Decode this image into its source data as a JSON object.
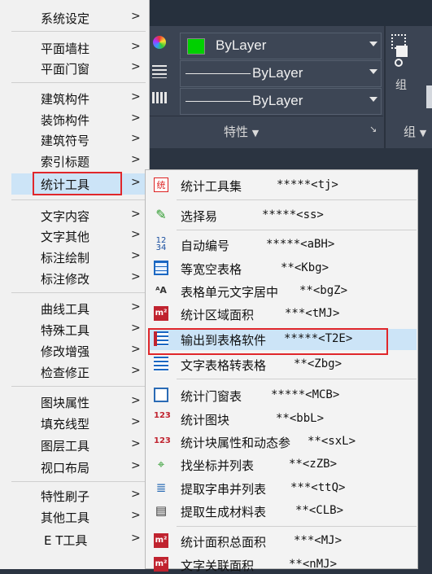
{
  "ribbon": {
    "color_value": "ByLayer",
    "linetype_value": "ByLayer",
    "lineweight_value": "ByLayer",
    "properties_label": "特性",
    "group_label": "组",
    "group_panel_label": "组",
    "color_swatch": "#00d000"
  },
  "left_menu": {
    "items": [
      {
        "label": "系统设定"
      },
      {
        "label": "平面墙柱"
      },
      {
        "label": "平面门窗"
      },
      {
        "label": "建筑构件"
      },
      {
        "label": "装饰构件"
      },
      {
        "label": "建筑符号"
      },
      {
        "label": "索引标题"
      },
      {
        "label": "统计工具"
      },
      {
        "label": "文字内容"
      },
      {
        "label": "文字其他"
      },
      {
        "label": "标注绘制"
      },
      {
        "label": "标注修改"
      },
      {
        "label": "曲线工具"
      },
      {
        "label": "特殊工具"
      },
      {
        "label": "修改增强"
      },
      {
        "label": "检查修正"
      },
      {
        "label": "图块属性"
      },
      {
        "label": "填充线型"
      },
      {
        "label": "图层工具"
      },
      {
        "label": "视口布局"
      },
      {
        "label": "特性刷子"
      },
      {
        "label": "其他工具"
      },
      {
        "label": "E T工具"
      }
    ],
    "selected": "统计工具"
  },
  "sub_menu": {
    "items": [
      {
        "icon": "tongji-tool-icon",
        "label": "统计工具集",
        "shortcut": "*****<tj>"
      },
      {
        "icon": "select-easy-icon",
        "label": "选择易",
        "shortcut": "*****<ss>"
      },
      {
        "icon": "auto-number-icon",
        "label": "自动编号",
        "shortcut": "*****<aBH>"
      },
      {
        "icon": "table-grid-icon",
        "label": "等宽空表格",
        "shortcut": "**<Kbg>"
      },
      {
        "icon": "cell-center-icon",
        "label": "表格单元文字居中",
        "shortcut": "**<bgZ>"
      },
      {
        "icon": "area-stats-icon",
        "label": "统计区域面积",
        "shortcut": "***<tMJ>"
      },
      {
        "icon": "export-table-icon",
        "label": "输出到表格软件",
        "shortcut": "*****<T2E>"
      },
      {
        "icon": "text-to-table-icon",
        "label": "文字表格转表格",
        "shortcut": "**<Zbg>"
      },
      {
        "icon": "door-window-icon",
        "label": "统计门窗表",
        "shortcut": "*****<MCB>"
      },
      {
        "icon": "block-count-icon",
        "label": "统计图块",
        "shortcut": "**<bbL>"
      },
      {
        "icon": "block-attr-icon",
        "label": "统计块属性和动态参",
        "shortcut": "**<sxL>"
      },
      {
        "icon": "coord-list-icon",
        "label": "找坐标并列表",
        "shortcut": "**<zZB>"
      },
      {
        "icon": "string-list-icon",
        "label": "提取字串并列表",
        "shortcut": "***<ttQ>"
      },
      {
        "icon": "material-table-icon",
        "label": "提取生成材料表",
        "shortcut": "**<CLB>"
      },
      {
        "icon": "total-area-icon",
        "label": "统计面积总面积",
        "shortcut": "***<MJ>"
      },
      {
        "icon": "text-link-area-icon",
        "label": "文字关联面积",
        "shortcut": "**<nMJ>"
      }
    ],
    "highlighted": "输出到表格软件"
  },
  "colors": {
    "highlight_border": "#e0272b",
    "selection_bg": "#cce4f7",
    "menu_bg": "#f1f1f1",
    "ribbon_bg": "#3b4453"
  }
}
